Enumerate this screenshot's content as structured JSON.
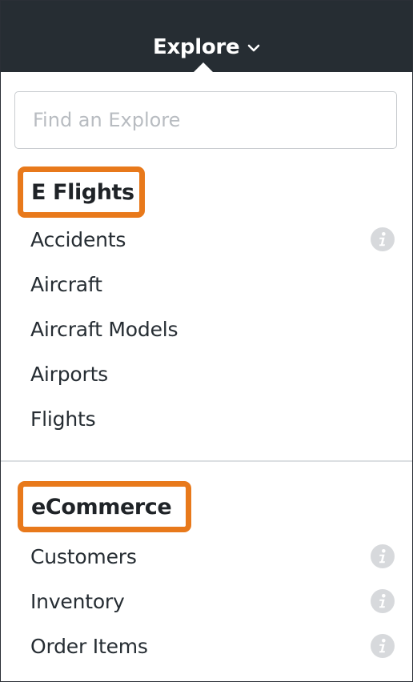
{
  "header": {
    "title": "Explore"
  },
  "search": {
    "placeholder": "Find an Explore"
  },
  "groups": [
    {
      "label": "E Flights",
      "items": [
        {
          "label": "Accidents",
          "info": true
        },
        {
          "label": "Aircraft",
          "info": false
        },
        {
          "label": "Aircraft Models",
          "info": false
        },
        {
          "label": "Airports",
          "info": false
        },
        {
          "label": "Flights",
          "info": false
        }
      ]
    },
    {
      "label": "eCommerce",
      "items": [
        {
          "label": "Customers",
          "info": true
        },
        {
          "label": "Inventory",
          "info": true
        },
        {
          "label": "Order Items",
          "info": true
        }
      ]
    }
  ],
  "colors": {
    "topbar": "#262d33",
    "highlight": "#e8791b",
    "info_icon": "#d7d9dc"
  },
  "icons": {
    "dropdown": "chevron-down-icon",
    "info": "info-icon"
  }
}
